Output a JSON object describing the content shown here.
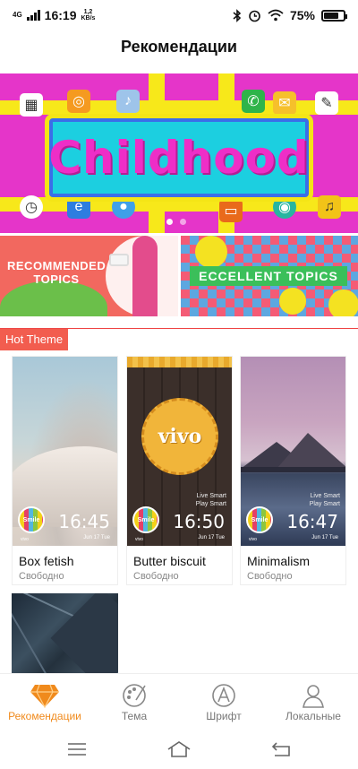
{
  "status": {
    "network": "4G",
    "time": "16:19",
    "speed_value": "1,2",
    "speed_unit": "KB/s",
    "battery": "75%",
    "battery_level": 0.75
  },
  "page": {
    "title": "Рекомендации"
  },
  "banner": {
    "text": "Childhood",
    "active_slide": 1,
    "slides": 2
  },
  "topics": [
    {
      "label": "RECOMMENDED TOPICS"
    },
    {
      "label": "ECCELLENT TOPICS"
    }
  ],
  "hot_theme": {
    "label": "Hot Theme"
  },
  "themes": [
    {
      "name": "Box fetish",
      "price": "Свободно",
      "clock": "16:45",
      "date": "Jun 17 Tue",
      "badge": "Smile",
      "brand": "vivo"
    },
    {
      "name": "Butter biscuit",
      "price": "Свободно",
      "clock": "16:50",
      "date": "Jun 17 Tue",
      "badge": "Smile",
      "brand": "vivo",
      "biscuit_text": "vivo",
      "slogan_1": "Live Smart",
      "slogan_2": "Play Smart"
    },
    {
      "name": "Minimalism",
      "price": "Свободно",
      "clock": "16:47",
      "date": "Jun 17 Tue",
      "badge": "Smile",
      "brand": "vivo",
      "slogan_1": "Live Smart",
      "slogan_2": "Play Smart"
    }
  ],
  "nav": {
    "items": [
      {
        "label": "Рекомендации",
        "icon": "diamond-icon",
        "active": true
      },
      {
        "label": "Тема",
        "icon": "palette-icon"
      },
      {
        "label": "Шрифт",
        "icon": "font-icon"
      },
      {
        "label": "Локальные",
        "icon": "person-icon"
      }
    ]
  },
  "colors": {
    "accent": "#f08a1c",
    "hot": "#f25d4f",
    "banner": "#e535c9"
  }
}
